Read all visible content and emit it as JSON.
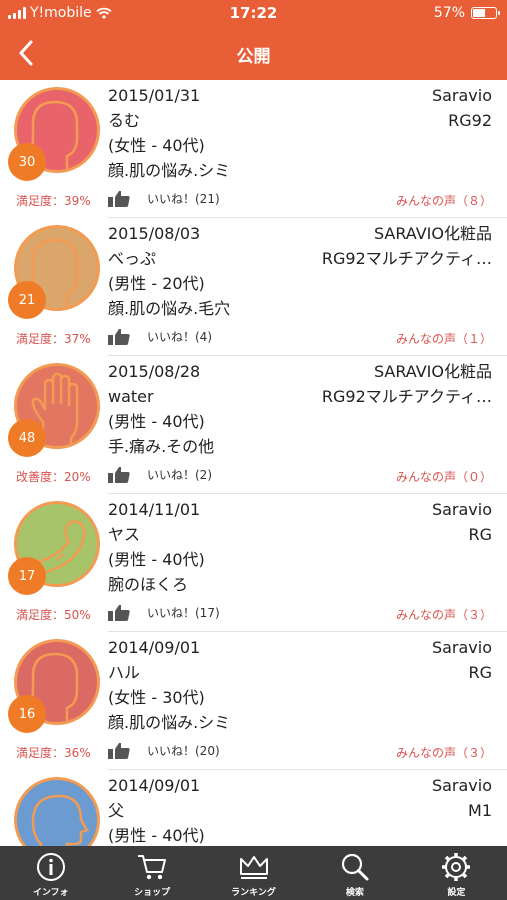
{
  "status_bar": {
    "carrier": "Y!mobile",
    "time": "17:22",
    "battery": "57%",
    "battery_level": 0.57
  },
  "header": {
    "title": "公開"
  },
  "items": [
    {
      "date": "2015/01/31",
      "name": "るむ",
      "gender_age": "(女性 - 40代)",
      "topic": "顔.肌の悩み.シミ",
      "maker": "Saravio",
      "product": "RG92",
      "badge": "30",
      "rating": "満足度：39%",
      "like_label": "いいね！(21)",
      "voices": "みんなの声（８）",
      "icon": "face-icon",
      "color": "#e8646a"
    },
    {
      "date": "2015/08/03",
      "name": "べっぷ",
      "gender_age": "(男性 - 20代)",
      "topic": "顔.肌の悩み.毛穴",
      "maker": "SARAVIO化粧品",
      "product": "RG92マルチアクティ…",
      "badge": "21",
      "rating": "満足度：37%",
      "like_label": "いいね！(4)",
      "voices": "みんなの声（１）",
      "icon": "face-icon",
      "color": "#dba66b"
    },
    {
      "date": "2015/08/28",
      "name": "water",
      "gender_age": "(男性 - 40代)",
      "topic": "手.痛み.その他",
      "maker": "SARAVIO化粧品",
      "product": "RG92マルチアクティ…",
      "badge": "48",
      "rating": "改善度：20%",
      "like_label": "いいね！(2)",
      "voices": "みんなの声（０）",
      "icon": "hand-icon",
      "color": "#e27661"
    },
    {
      "date": "2014/11/01",
      "name": "ヤス",
      "gender_age": "(男性 - 40代)",
      "topic": "腕のほくろ",
      "maker": "Saravio",
      "product": "RG",
      "badge": "17",
      "rating": "満足度：50%",
      "like_label": "いいね！(17)",
      "voices": "みんなの声（３）",
      "icon": "arm-icon",
      "color": "#a8c46a"
    },
    {
      "date": "2014/09/01",
      "name": "ハル",
      "gender_age": "(女性 - 30代)",
      "topic": "顔.肌の悩み.シミ",
      "maker": "Saravio",
      "product": "RG",
      "badge": "16",
      "rating": "満足度：36%",
      "like_label": "いいね！(20)",
      "voices": "みんなの声（３）",
      "icon": "face-icon",
      "color": "#dc6a64"
    },
    {
      "date": "2014/09/01",
      "name": "父",
      "gender_age": "(男性 - 40代)",
      "topic": "",
      "maker": "Saravio",
      "product": "M1",
      "badge": "",
      "rating": "",
      "like_label": "",
      "voices": "",
      "icon": "head-side-icon",
      "color": "#6b9bd1"
    }
  ],
  "tabs": [
    {
      "label": "インフォ",
      "icon": "info-icon"
    },
    {
      "label": "ショップ",
      "icon": "cart-icon"
    },
    {
      "label": "ランキング",
      "icon": "crown-icon"
    },
    {
      "label": "検索",
      "icon": "search-icon"
    },
    {
      "label": "設定",
      "icon": "gear-icon"
    }
  ],
  "colors": {
    "accent": "#e85e36",
    "badge": "#f07b27",
    "rating_text": "#d9534f",
    "tabbar": "#3c3c3c"
  }
}
